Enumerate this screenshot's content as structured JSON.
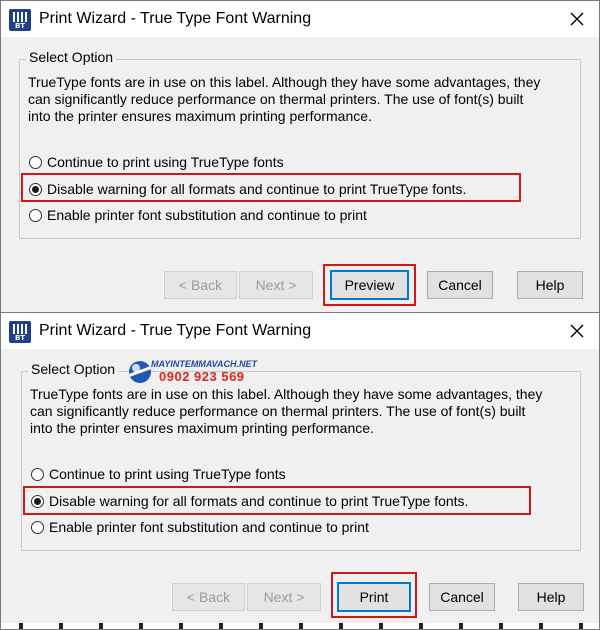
{
  "dialogs": [
    {
      "title": "Print Wizard - True Type Font Warning",
      "group_label": "Select Option",
      "description": "TrueType fonts are in use on this label. Although they have some advantages, they can significantly reduce performance on thermal printers. The use of font(s) built into the printer ensures maximum printing performance.",
      "options": [
        {
          "label": "Continue to print using TrueType fonts",
          "checked": false
        },
        {
          "label": "Disable warning for all formats and continue to print TrueType fonts.",
          "checked": true
        },
        {
          "label": "Enable printer font substitution and continue to print",
          "checked": false
        }
      ],
      "buttons": {
        "back": "< Back",
        "next": "Next >",
        "primary": "Preview",
        "cancel": "Cancel",
        "help": "Help"
      }
    },
    {
      "title": "Print Wizard - True Type Font Warning",
      "group_label": "Select Option",
      "description": "TrueType fonts are in use on this label. Although they have some advantages, they can significantly reduce performance on thermal printers. The use of font(s) built into the printer ensures maximum printing performance.",
      "options": [
        {
          "label": "Continue to print using TrueType fonts",
          "checked": false
        },
        {
          "label": "Disable warning for all formats and continue to print TrueType fonts.",
          "checked": true
        },
        {
          "label": "Enable printer font substitution and continue to print",
          "checked": false
        }
      ],
      "buttons": {
        "back": "< Back",
        "next": "Next >",
        "primary": "Print",
        "cancel": "Cancel",
        "help": "Help"
      }
    }
  ],
  "watermark": {
    "site": "MAYINTEMMAVACH.NET",
    "phone": "0902 923 569"
  },
  "colors": {
    "highlight_border": "#d01818",
    "default_button_border": "#0078d7",
    "dialog_bg": "#f0f0f0",
    "app_icon": "#1f3f91"
  },
  "icons": [
    "bartender-app-icon",
    "close-icon",
    "radio-button"
  ]
}
